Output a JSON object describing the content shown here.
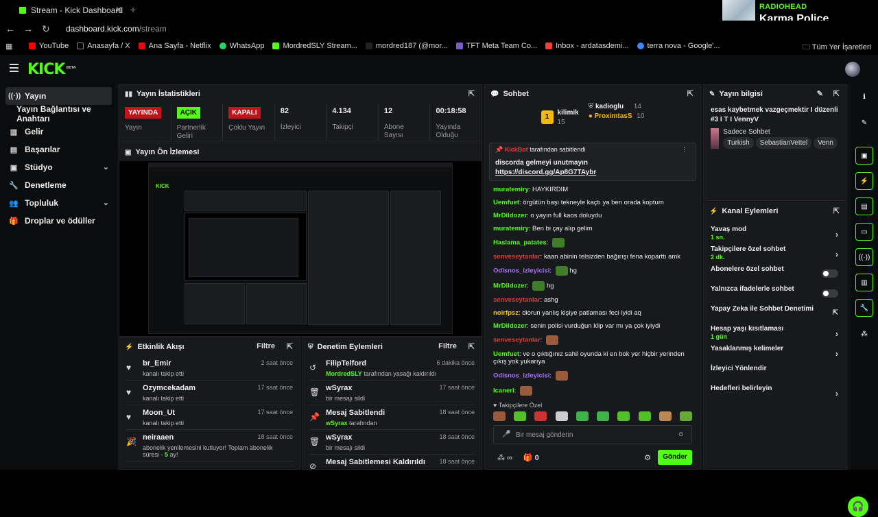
{
  "browser": {
    "tab_title": "Stream - Kick Dashboard",
    "url_host": "dashboard.kick.com",
    "url_path": "/stream",
    "bookmarks": [
      "YouTube",
      "Anasayfa / X",
      "Ana Sayfa - Netflix",
      "WhatsApp",
      "MordredSLY Stream...",
      "mordred187 (@mor...",
      "TFT Meta Team Co...",
      "Inbox - ardatasdemi...",
      "terra nova - Google'..."
    ],
    "bookmarks_right": "Tüm Yer İşaretleri"
  },
  "music": {
    "artist": "RADIOHEAD",
    "song": "Karma Police"
  },
  "logo": "KICK",
  "logo_badge": "BETA",
  "sidebar": {
    "items": [
      {
        "label": "Yayın",
        "icon": "stream-icon"
      },
      {
        "label": "Yayın Bağlantısı ve Anahtarı"
      },
      {
        "label": "Gelir",
        "icon": "revenue-icon"
      },
      {
        "label": "Başarılar",
        "icon": "achievements-icon"
      },
      {
        "label": "Stüdyo",
        "icon": "studio-icon"
      },
      {
        "label": "Denetleme",
        "icon": "moderation-icon"
      },
      {
        "label": "Topluluk",
        "icon": "community-icon"
      },
      {
        "label": "Droplar ve ödüller",
        "icon": "drops-icon"
      }
    ]
  },
  "stats": {
    "title": "Yayın İstatistikleri",
    "items": [
      {
        "value": "YAYINDA",
        "label": "Yayın",
        "style": "red"
      },
      {
        "value": "AÇIK",
        "label": "Partnerlik Geliri",
        "style": "green"
      },
      {
        "value": "KAPALI",
        "label": "Çoklu Yayın",
        "style": "red"
      },
      {
        "value": "82",
        "label": "İzleyici"
      },
      {
        "value": "4.134",
        "label": "Takipçi"
      },
      {
        "value": "12",
        "label": "Abone Sayısı"
      },
      {
        "value": "00:18:58",
        "label": "Yayında Olduğu"
      }
    ]
  },
  "preview": {
    "title": "Yayın Ön İzlemesi"
  },
  "activity": {
    "title": "Etkinlik Akışı",
    "filter": "Filtre",
    "items": [
      {
        "user": "br_Emir",
        "text": "kanalı takip etti",
        "time": "2 saat önce"
      },
      {
        "user": "Ozymcekadam",
        "text": "kanalı takip etti",
        "time": "17 saat önce"
      },
      {
        "user": "Moon_Ut",
        "text": "kanalı takip etti",
        "time": "17 saat önce"
      },
      {
        "user": "neiraaen",
        "text": "abonelik yenilemesini kutluyor! Toplam abonelik süresi - ",
        "bold": "5",
        "tail": " ay!",
        "time": "18 saat önce"
      }
    ]
  },
  "modlog": {
    "title": "Denetim Eylemleri",
    "filter": "Filtre",
    "items": [
      {
        "title": "FilipTelford",
        "who": "MordredSLY",
        "text": " tarafından yasağı kaldırıldı",
        "time": "6 dakika önce"
      },
      {
        "title": "wSyrax",
        "who": "",
        "text": "bir mesajı sildi",
        "time": "17 saat önce"
      },
      {
        "title": "Mesaj Sabitlendi",
        "who": "wSyrax",
        "text": " tarafından",
        "time": "18 saat önce"
      },
      {
        "title": "wSyrax",
        "who": "",
        "text": "bir mesajı sildi",
        "time": "18 saat önce"
      },
      {
        "title": "Mesaj Sabitlemesi Kaldırıldı",
        "who": "",
        "text": "",
        "time": "18 saat önce"
      }
    ]
  },
  "chat": {
    "title": "Sohbet",
    "leaderboard": {
      "first": "kilimik",
      "first_count": "15",
      "second": "kadioglu",
      "second_count": "14",
      "third": "ProximtasS",
      "third_count": "10",
      "rank": "1"
    },
    "pinned": {
      "by": "KickBot",
      "by_text": "tarafından sabitlendi",
      "line1": "discorda gelmeyi unutmayın",
      "line2": "https://discord.gg/Ap8G7TAybr"
    },
    "messages": [
      {
        "user": "muratemiry",
        "color": "#53fc18",
        "text": "HAYKIRDIM"
      },
      {
        "user": "Uemfuet",
        "color": "#53fc18",
        "text": "örgütün başı tekneyle kaçtı ya ben orada koptum"
      },
      {
        "user": "MrDildozer",
        "color": "#53fc18",
        "text": "o yayın full kaos doluydu"
      },
      {
        "user": "muratemiry",
        "color": "#53fc18",
        "text": "Ben bi çay alıp gelim"
      },
      {
        "user": "Haslama_patates",
        "color": "#53fc18",
        "text": "",
        "emote": "#3f7d2a"
      },
      {
        "user": "senveseytanlar",
        "color": "#e03b3b",
        "text": "kaan abinin telsizden bağırışı fena koparttı amk"
      },
      {
        "user": "Odisnos_izleyicisi",
        "color": "#a970ff",
        "text": "hg",
        "emote": "#3f7d2a"
      },
      {
        "user": "MrDildozer",
        "color": "#53fc18",
        "text": "hg",
        "emote": "#3f7d2a"
      },
      {
        "user": "senveseytanlar",
        "color": "#e03b3b",
        "text": "ashg"
      },
      {
        "user": "noirfpsz",
        "color": "#f0c419",
        "text": "diorun yanlış kişiye patlaması feci iyidi aq"
      },
      {
        "user": "MrDildozer",
        "color": "#53fc18",
        "text": "senin polisi vurduğun klip var mı ya çok iyiydi"
      },
      {
        "user": "senveseytanlar",
        "color": "#e03b3b",
        "text": "",
        "emote": "#9a5b3c"
      },
      {
        "user": "Uemfuet",
        "color": "#53fc18",
        "text": "ve o çıktığınız sahil oyunda ki en bok yer hiçbir yerinden çıkış yok yukarıya"
      },
      {
        "user": "Odisnos_izleyicisi",
        "color": "#a970ff",
        "text": "",
        "emote": "#9a5b3c"
      },
      {
        "user": "Icaneri",
        "color": "#53fc18",
        "text": "",
        "emote": "#9a5b3c"
      }
    ],
    "followers_only": "Takipçilere Özel",
    "placeholder": "Bir mesaj gönderin",
    "gift_count": "0",
    "send": "Gönder"
  },
  "info": {
    "title": "Yayın bilgisi",
    "stream_title": "esas kaybetmek vazgeçmektir I düzenli #3 I T I VennyV",
    "category": "Sadece Sohbet",
    "tags": [
      "Turkish",
      "SebastianVettel",
      "Venn"
    ]
  },
  "actions": {
    "title": "Kanal Eylemleri",
    "items": [
      {
        "label": "Yavaş mod",
        "sub": "1 sn.",
        "type": "chev"
      },
      {
        "label": "Takipçilere özel sohbet",
        "sub": "2 dk.",
        "type": "chev"
      },
      {
        "label": "Abonelere özel sohbet",
        "sub": "",
        "type": "toggle"
      },
      {
        "label": "Yalnızca ifadelerle sohbet",
        "sub": "",
        "type": "toggle"
      },
      {
        "label": "Yapay Zeka ile Sohbet Denetimi",
        "sub": "",
        "type": "ext"
      },
      {
        "label": "Hesap yaşı kısıtlaması",
        "sub": "1 gün",
        "type": "chev"
      },
      {
        "label": "Yasaklanmış kelimeler",
        "sub": "",
        "type": "chev"
      },
      {
        "label": "İzleyici Yönlendir",
        "sub": "",
        "type": "none"
      },
      {
        "label": "Hedefleri belirleyin",
        "sub": "",
        "type": "chev"
      }
    ]
  }
}
